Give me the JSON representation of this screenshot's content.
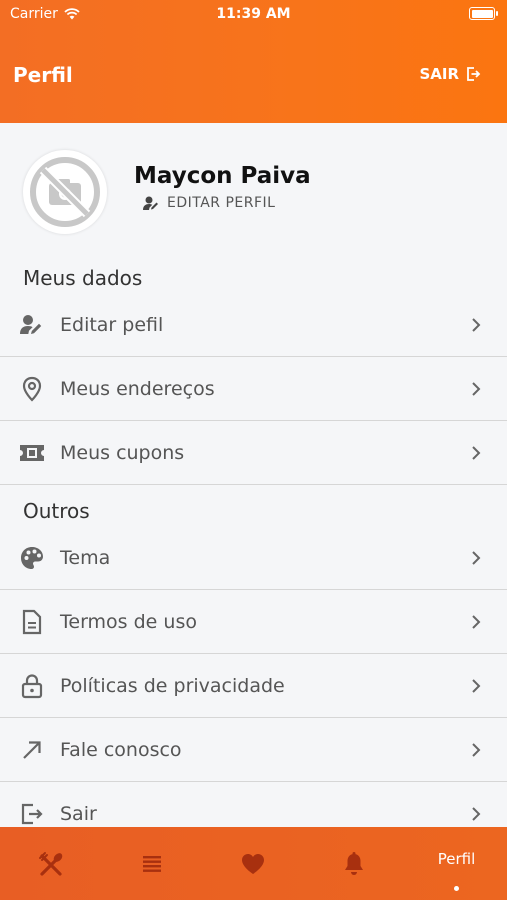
{
  "status_bar": {
    "carrier": "Carrier",
    "time": "11:39 AM"
  },
  "header": {
    "title": "Perfil",
    "logout_label": "SAIR"
  },
  "profile": {
    "name": "Maycon Paiva",
    "edit_label": "EDITAR PERFIL"
  },
  "sections": {
    "meus_dados": {
      "title": "Meus dados",
      "items": [
        {
          "label": "Editar pefil",
          "icon": "user-edit-icon"
        },
        {
          "label": "Meus endereços",
          "icon": "map-pin-icon"
        },
        {
          "label": "Meus cupons",
          "icon": "ticket-icon"
        }
      ]
    },
    "outros": {
      "title": "Outros",
      "items": [
        {
          "label": "Tema",
          "icon": "palette-icon"
        },
        {
          "label": "Termos de uso",
          "icon": "document-icon"
        },
        {
          "label": "Políticas de privacidade",
          "icon": "lock-icon"
        },
        {
          "label": "Fale conosco",
          "icon": "arrow-up-right-icon"
        },
        {
          "label": "Sair",
          "icon": "logout-icon"
        }
      ]
    }
  },
  "tabbar": {
    "tabs": [
      {
        "icon": "utensils-icon"
      },
      {
        "icon": "list-icon"
      },
      {
        "icon": "heart-icon"
      },
      {
        "icon": "bell-icon"
      },
      {
        "label": "Perfil",
        "active": true
      }
    ]
  },
  "colors": {
    "accent": "#f8741a",
    "tabbar": "#ea6222",
    "text_muted": "#555555",
    "divider": "#d6d6d6"
  }
}
